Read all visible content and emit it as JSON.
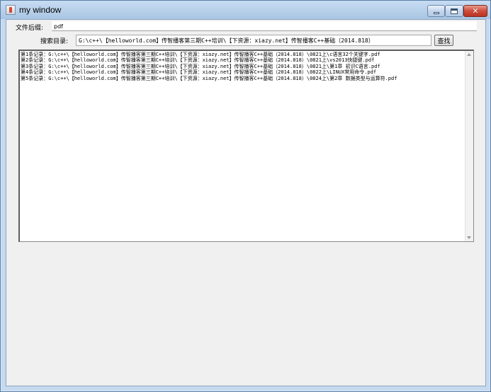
{
  "window": {
    "title": "my window"
  },
  "form": {
    "suffix_label": "文件后缀:",
    "suffix_value": "pdf",
    "dir_label": "搜索目录:",
    "dir_value": "G:\\c++\\【helloworld.com】传智播客第三期C++培训\\【下资源：xiazy.net】传智播客C++基础（2014.818）",
    "search_label": "查找"
  },
  "results": [
    "第1条记录：G:\\c++\\【helloworld.com】传智播客第三期C++培训\\【下资源：xiazy.net】传智播客C++基础（2014.818）\\0821上\\c语言32个关键字.pdf",
    "第2条记录：G:\\c++\\【helloworld.com】传智播客第三期C++培训\\【下资源：xiazy.net】传智播客C++基础（2014.818）\\0821上\\vs2013快捷键.pdf",
    "第3条记录：G:\\c++\\【helloworld.com】传智播客第三期C++培训\\【下资源：xiazy.net】传智播客C++基础（2014.818）\\0821上\\第1章 初识C语言.pdf",
    "第4条记录：G:\\c++\\【helloworld.com】传智播客第三期C++培训\\【下资源：xiazy.net】传智播客C++基础（2014.818）\\0822上\\LINUX常用命令.pdf",
    "第5条记录：G:\\c++\\【helloworld.com】传智播客第三期C++培训\\【下资源：xiazy.net】传智播客C++基础（2014.818）\\0824上\\第2章 数据类型与运算符.pdf"
  ],
  "icons": {
    "app": "java-app-icon",
    "minimize": "minimize-icon",
    "maximize": "maximize-icon",
    "close": "close-icon"
  }
}
